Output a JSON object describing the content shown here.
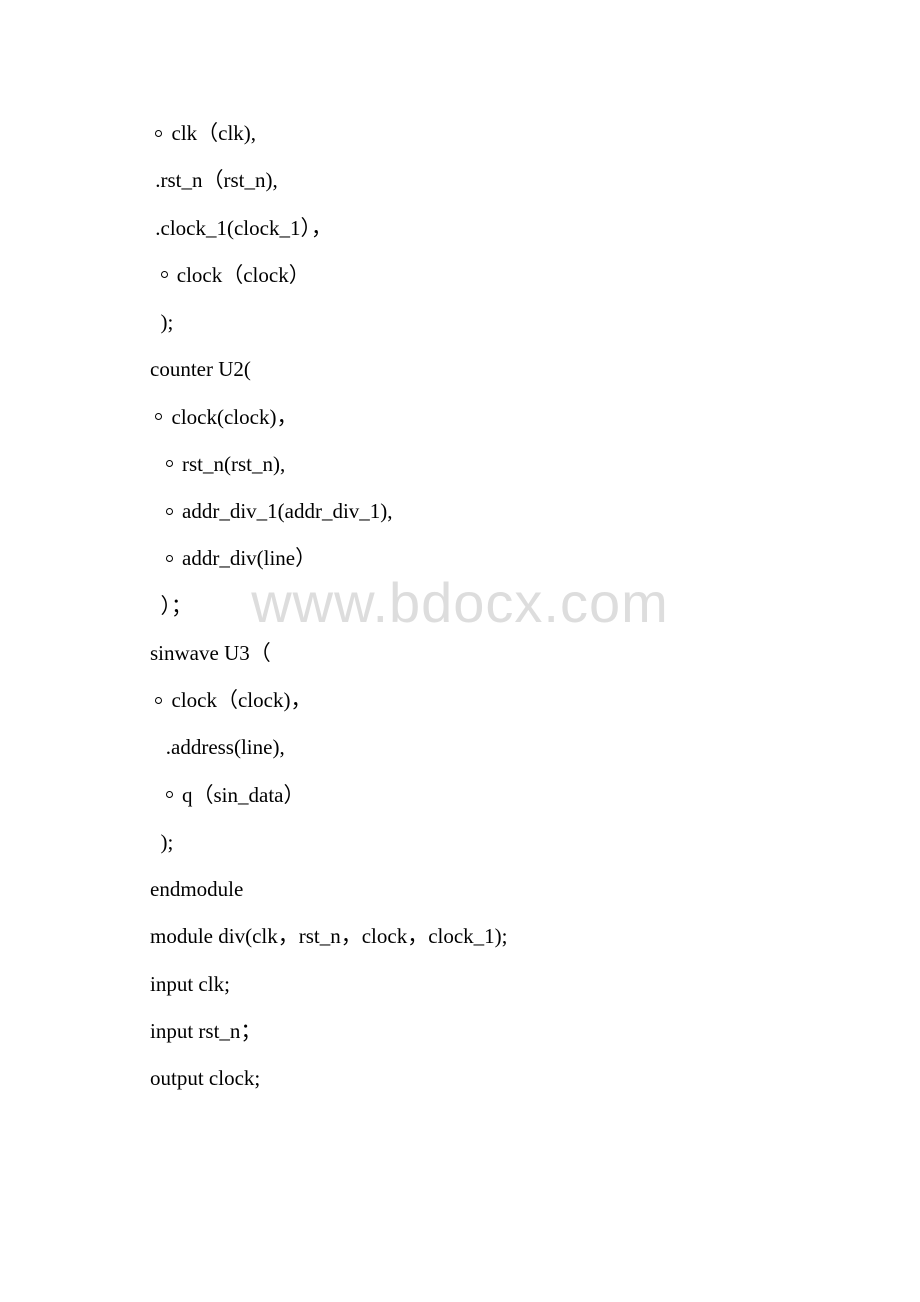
{
  "watermark": "www.bdocx.com",
  "lines": {
    "l1": " clk（clk),",
    "l2": " .rst_n（rst_n),",
    "l3": " .clock_1(clock_1），",
    "l4": " clock（clock）",
    "l5": "  );",
    "l6": "",
    "l7": "counter U2(",
    "l8": " clock(clock)，",
    "l9": " rst_n(rst_n),",
    "l10": " addr_div_1(addr_div_1),",
    "l11": " addr_div(line）",
    "l12": "  ）；",
    "l13": "",
    "l14": "sinwave U3（",
    "l15": " clock（clock)，",
    "l16": "   .address(line),",
    "l17": " q（sin_data）",
    "l18": "  );",
    "l19": "",
    "l20": "endmodule",
    "l21": "",
    "l22": "module div(clk，rst_n，clock，clock_1);",
    "l23": "input clk;",
    "l24": "input rst_n；",
    "l25": "output clock;"
  }
}
